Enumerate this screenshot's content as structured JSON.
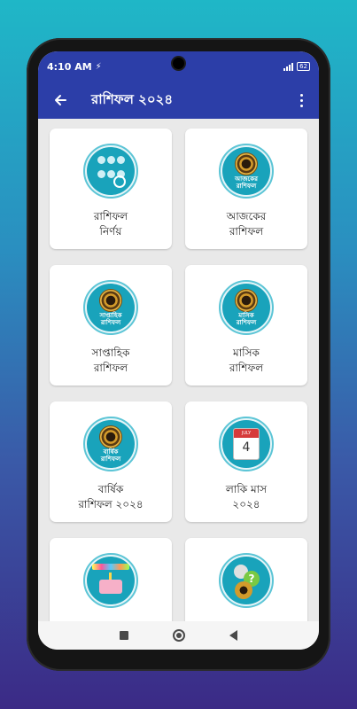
{
  "status_bar": {
    "time": "4:10 AM",
    "notification": "⚡",
    "battery": "62"
  },
  "app_bar": {
    "title": "রাশিফল ২০২৪"
  },
  "cards": [
    {
      "title_line1": "রাশিফল",
      "title_line2": "নির্ণয়",
      "icon": "zodiac-search-icon",
      "icon_text": ""
    },
    {
      "title_line1": "আজকের",
      "title_line2": "রাশিফল",
      "icon": "zodiac-wheel-icon",
      "icon_text": "আজকের\nরাশিফল"
    },
    {
      "title_line1": "সাপ্তাহিক",
      "title_line2": "রাশিফল",
      "icon": "zodiac-wheel-icon",
      "icon_text": "সাপ্তাহিক\nরাশিফল"
    },
    {
      "title_line1": "মাসিক",
      "title_line2": "রাশিফল",
      "icon": "zodiac-wheel-icon",
      "icon_text": "মাসিক\nরাশিফল"
    },
    {
      "title_line1": "বার্ষিক",
      "title_line2": "রাশিফল ২০২৪",
      "icon": "zodiac-wheel-icon",
      "icon_text": "বার্ষিক\nরাশিফল"
    },
    {
      "title_line1": "লাকি মাস",
      "title_line2": "২০২৪",
      "icon": "calendar-icon",
      "icon_text": "JULY",
      "calendar_day": "4"
    },
    {
      "title_line1": "",
      "title_line2": "",
      "icon": "birthday-cake-icon",
      "icon_text": ""
    },
    {
      "title_line1": "",
      "title_line2": "",
      "icon": "moon-question-icon",
      "icon_text": "?"
    }
  ],
  "colors": {
    "app_bar": "#2c3ea8",
    "icon_teal": "#19a3bb",
    "background": "#e9e9e9"
  }
}
